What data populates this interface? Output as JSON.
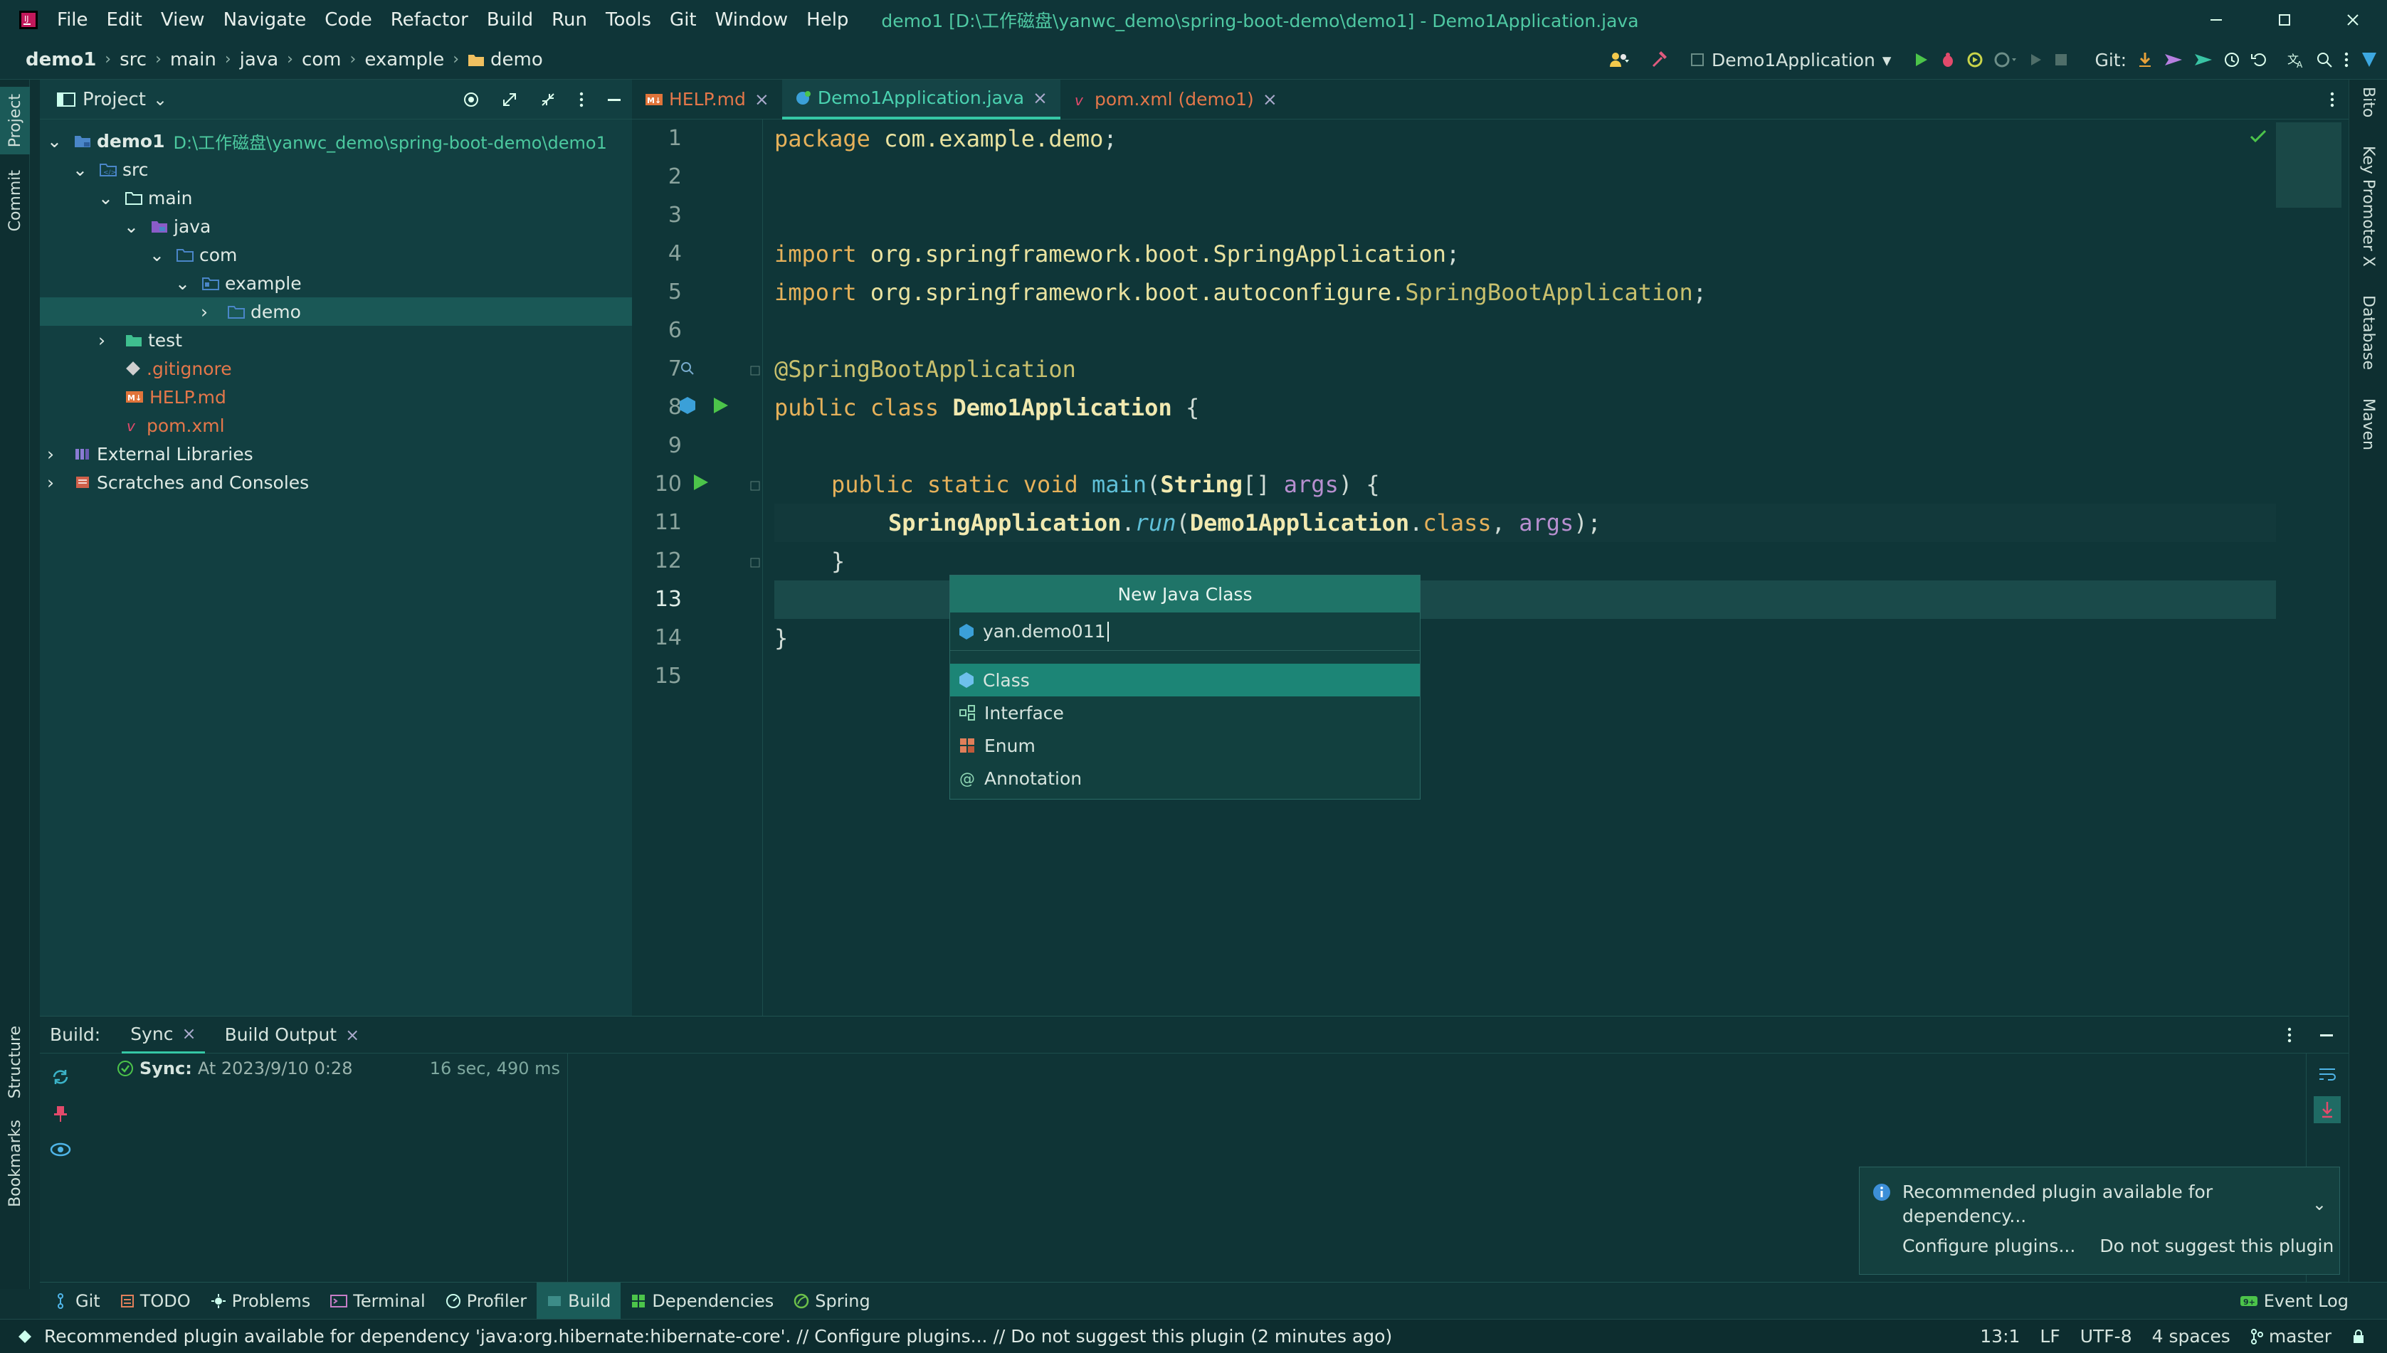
{
  "titlebar": {
    "menu": [
      "File",
      "Edit",
      "View",
      "Navigate",
      "Code",
      "Refactor",
      "Build",
      "Run",
      "Tools",
      "Git",
      "Window",
      "Help"
    ],
    "title": "demo1 [D:\\工作磁盘\\yanwc_demo\\spring-boot-demo\\demo1] - Demo1Application.java"
  },
  "navbar": {
    "crumbs": [
      "demo1",
      "src",
      "main",
      "java",
      "com",
      "example",
      "demo"
    ],
    "run_config": "Demo1Application",
    "git_label": "Git:"
  },
  "left_stripe": {
    "project": "Project",
    "commit": "Commit",
    "structure": "Structure",
    "bookmarks": "Bookmarks"
  },
  "right_stripe": {
    "bito": "Bito",
    "key_promoter": "Key Promoter X",
    "database": "Database",
    "maven": "Maven"
  },
  "project": {
    "header": "Project",
    "root_name": "demo1",
    "root_path": "D:\\工作磁盘\\yanwc_demo\\spring-boot-demo\\demo1",
    "items": [
      {
        "label": "src"
      },
      {
        "label": "main"
      },
      {
        "label": "java"
      },
      {
        "label": "com"
      },
      {
        "label": "example"
      },
      {
        "label": "demo"
      },
      {
        "label": "test"
      },
      {
        "label": ".gitignore"
      },
      {
        "label": "HELP.md"
      },
      {
        "label": "pom.xml"
      },
      {
        "label": "External Libraries"
      },
      {
        "label": "Scratches and Consoles"
      }
    ]
  },
  "tabs": [
    {
      "label": "HELP.md",
      "icon": "markdown-icon"
    },
    {
      "label": "Demo1Application.java",
      "icon": "java-class-icon"
    },
    {
      "label": "pom.xml (demo1)",
      "icon": "maven-icon"
    }
  ],
  "editor": {
    "line_numbers": [
      "1",
      "2",
      "3",
      "4",
      "5",
      "6",
      "7",
      "8",
      "9",
      "10",
      "11",
      "12",
      "13",
      "14",
      "15"
    ],
    "code": {
      "l1_kw": "package ",
      "l1_pkg": "com.example.demo",
      "l1_end": ";",
      "l4_kw": "import ",
      "l4_pkg": "org.springframework.boot.SpringApplication",
      "l4_end": ";",
      "l5_kw": "import ",
      "l5_pkg": "org.springframework.boot.autoconfigure.",
      "l5_cls": "SpringBootApplication",
      "l5_end": ";",
      "l7_ann": "@SpringBootApplication",
      "l8_kw": "public class ",
      "l8_cls": "Demo1Application",
      "l8_end": " {",
      "l10_kw": "public static void ",
      "l10_fn": "main",
      "l10_p1": "(",
      "l10_type": "String",
      "l10_p2": "[] ",
      "l10_var": "args",
      "l10_end": ") {",
      "l11_cls": "SpringApplication",
      "l11_dot": ".",
      "l11_fn": "run",
      "l11_p1": "(",
      "l11_cls2": "Demo1Application",
      "l11_dot2": ".",
      "l11_kw": "class",
      "l11_comma": ", ",
      "l11_var": "args",
      "l11_end": ");",
      "l12": "}",
      "l14": "}"
    }
  },
  "popup": {
    "title": "New Java Class",
    "input_value": "yan.demo011",
    "options": [
      "Class",
      "Interface",
      "Enum",
      "Annotation"
    ]
  },
  "build": {
    "label": "Build:",
    "tabs": [
      "Sync",
      "Build Output"
    ],
    "sync_title": "Sync:",
    "sync_time": "At 2023/9/10 0:28",
    "sync_duration": "16 sec, 490 ms"
  },
  "notification": {
    "text": "Recommended plugin available for dependency...",
    "action1": "Configure plugins...",
    "action2": "Do not suggest this plugin"
  },
  "toolwindows": [
    "Git",
    "TODO",
    "Problems",
    "Terminal",
    "Profiler",
    "Build",
    "Dependencies",
    "Spring"
  ],
  "event_log": "Event Log",
  "statusbar": {
    "message": "Recommended plugin available for dependency 'java:org.hibernate:hibernate-core'. // Configure plugins... // Do not suggest this plugin (2 minutes ago)",
    "position": "13:1",
    "line_sep": "LF",
    "encoding": "UTF-8",
    "indent": "4 spaces",
    "branch": "master"
  },
  "colors": {
    "accent": "#35c7a5",
    "background": "#0f3638",
    "selection": "#1c8576"
  }
}
